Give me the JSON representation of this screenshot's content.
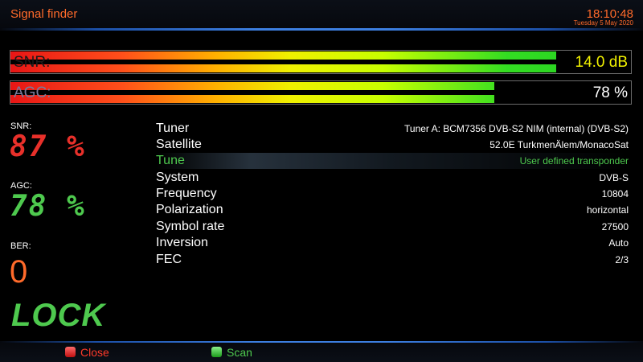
{
  "header": {
    "title": "Signal finder",
    "time": "18:10:48",
    "date": "Tuesday  5 May 2020"
  },
  "bars": {
    "snr": {
      "label": "SNR:",
      "value": "14.0 dB",
      "fill": 0.88,
      "label_color": "#1a1a1a",
      "value_color": "#f0f000"
    },
    "agc": {
      "label": "AGC:",
      "value": "78 %",
      "fill": 0.78,
      "label_color": "#7a7a9a",
      "value_color": "#ffffff"
    }
  },
  "side": {
    "snr_label": "SNR:",
    "snr_value": "87 %",
    "agc_label": "AGC:",
    "agc_value": "78 %",
    "ber_label": "BER:",
    "ber_value": "0",
    "lock": "LOCK"
  },
  "info": [
    {
      "label": "Tuner",
      "value": "Tuner A: BCM7356 DVB-S2 NIM (internal) (DVB-S2)"
    },
    {
      "label": "Satellite",
      "value": "52.0E TurkmenÄlem/MonacoSat"
    },
    {
      "label": "Tune",
      "value": "User defined transponder",
      "selected": true
    },
    {
      "label": "System",
      "value": "DVB-S"
    },
    {
      "label": "Frequency",
      "value": "10804"
    },
    {
      "label": "Polarization",
      "value": "horizontal"
    },
    {
      "label": "Symbol rate",
      "value": "27500"
    },
    {
      "label": "Inversion",
      "value": "Auto"
    },
    {
      "label": "FEC",
      "value": "2/3"
    }
  ],
  "footer": {
    "close_label": "Close",
    "scan_label": "Scan"
  },
  "colors": {
    "accent_orange": "#ff6a2a",
    "digit_red": "#e8302a",
    "digit_green": "#4ec94e",
    "red_button": "#e02020",
    "green_button": "#2ec02e"
  }
}
